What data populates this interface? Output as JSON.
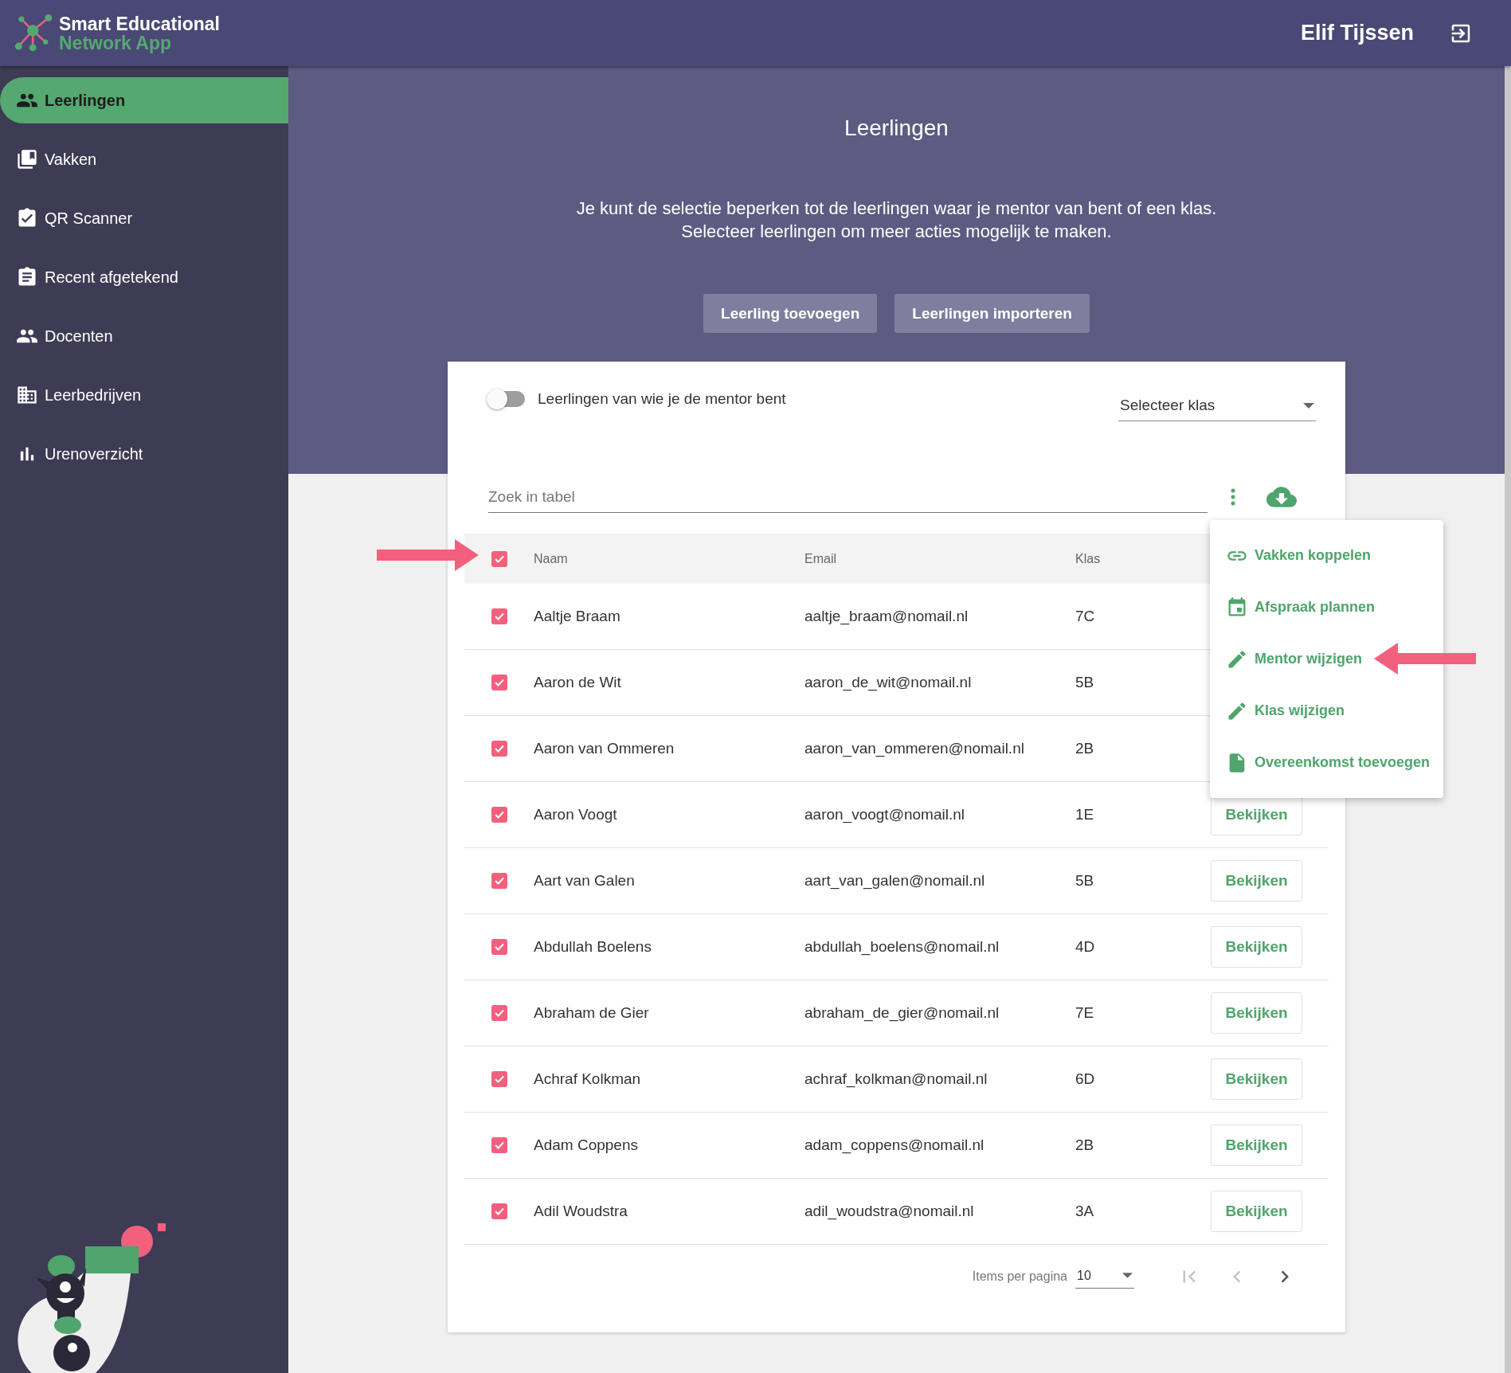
{
  "app": {
    "logo_line1": "Smart Educational",
    "logo_line2": "Network App",
    "user": "Elif Tijssen"
  },
  "sidebar": {
    "items": [
      {
        "label": "Leerlingen",
        "selected": true
      },
      {
        "label": "Vakken",
        "selected": false
      },
      {
        "label": "QR Scanner",
        "selected": false
      },
      {
        "label": "Recent afgetekend",
        "selected": false
      },
      {
        "label": "Docenten",
        "selected": false
      },
      {
        "label": "Leerbedrijven",
        "selected": false
      },
      {
        "label": "Urenoverzicht",
        "selected": false
      }
    ]
  },
  "page": {
    "title": "Leerlingen",
    "description": [
      "Je kunt de selectie beperken tot de leerlingen waar je mentor van bent of een klas.",
      "Selecteer leerlingen om meer acties mogelijk te maken."
    ],
    "buttons": [
      "Leerling toevoegen",
      "Leerlingen importeren"
    ]
  },
  "filters": {
    "mentor_toggle": {
      "label": "Leerlingen van wie je de mentor bent",
      "on": false
    },
    "class_select": {
      "placeholder": "Selecteer klas"
    }
  },
  "search": {
    "placeholder": "Zoek in tabel"
  },
  "table": {
    "select_all": {
      "checked": true
    },
    "columns": [
      "Naam",
      "Email",
      "Klas"
    ],
    "rows": [
      {
        "name": "Aaltje Braam",
        "email": "aaltje_braam@nomail.nl",
        "class": "7C",
        "checked": true
      },
      {
        "name": "Aaron de Wit",
        "email": "aaron_de_wit@nomail.nl",
        "class": "5B",
        "checked": true
      },
      {
        "name": "Aaron van Ommeren",
        "email": "aaron_van_ommeren@nomail.nl",
        "class": "2B",
        "checked": true
      },
      {
        "name": "Aaron Voogt",
        "email": "aaron_voogt@nomail.nl",
        "class": "1E",
        "checked": true,
        "action": "Bekijken"
      },
      {
        "name": "Aart van Galen",
        "email": "aart_van_galen@nomail.nl",
        "class": "5B",
        "checked": true,
        "action": "Bekijken"
      },
      {
        "name": "Abdullah Boelens",
        "email": "abdullah_boelens@nomail.nl",
        "class": "4D",
        "checked": true,
        "action": "Bekijken"
      },
      {
        "name": "Abraham de Gier",
        "email": "abraham_de_gier@nomail.nl",
        "class": "7E",
        "checked": true,
        "action": "Bekijken"
      },
      {
        "name": "Achraf Kolkman",
        "email": "achraf_kolkman@nomail.nl",
        "class": "6D",
        "checked": true,
        "action": "Bekijken"
      },
      {
        "name": "Adam Coppens",
        "email": "adam_coppens@nomail.nl",
        "class": "2B",
        "checked": true,
        "action": "Bekijken"
      },
      {
        "name": "Adil Woudstra",
        "email": "adil_woudstra@nomail.nl",
        "class": "3A",
        "checked": true,
        "action": "Bekijken"
      }
    ]
  },
  "menu": {
    "items": [
      {
        "label": "Vakken koppelen"
      },
      {
        "label": "Afspraak plannen"
      },
      {
        "label": "Mentor wijzigen"
      },
      {
        "label": "Klas wijzigen"
      },
      {
        "label": "Overeenkomst toevoegen"
      }
    ]
  },
  "pagination": {
    "label": "Items per pagina",
    "page_size": "10",
    "first_disabled": true,
    "prev_disabled": true,
    "next_disabled": false
  }
}
